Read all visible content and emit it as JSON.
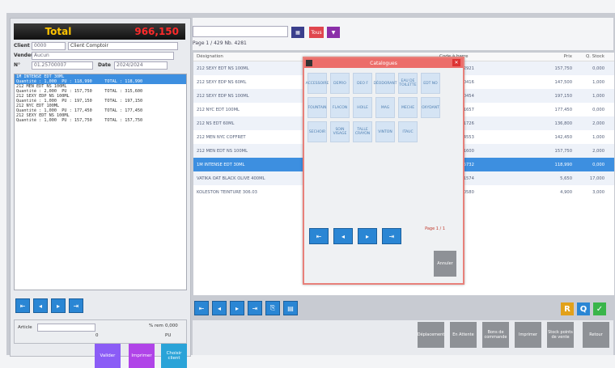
{
  "header": {
    "total_label": "Total",
    "total_value": "966,150"
  },
  "client": {
    "client_label": "Client",
    "client_code": "0000",
    "client_name": "Client Comptoir",
    "vendeur_label": "Vendeur",
    "vendeur_value": "Aucun",
    "no_label": "N°",
    "no_value": "01.25700007",
    "date_label": "Date",
    "date_value": "2024/2024"
  },
  "ticket_lines": [
    {
      "text": "1M INTENSE EDT 30ML",
      "sel": true
    },
    {
      "text": "Quantité : 1,000  PU : 118,990     TOTAL : 118,990",
      "sel": true
    },
    {
      "text": "212 MEN EDT NS 100ML",
      "sel": false
    },
    {
      "text": "Quantité : 2,000  PU : 157,750     TOTAL : 315,600",
      "sel": false
    },
    {
      "text": "212 SEXY EDP NS 100ML",
      "sel": false
    },
    {
      "text": "Quantité : 1,000  PU : 197,150     TOTAL : 197,150",
      "sel": false
    },
    {
      "text": "212 NYC EDT 100ML",
      "sel": false
    },
    {
      "text": "Quantité : 1,000  PU : 177,450     TOTAL : 177,450",
      "sel": false
    },
    {
      "text": "212 SEXY EDT NS 100ML",
      "sel": false
    },
    {
      "text": "Quantité : 1,000  PU : 157,750     TOTAL : 157,750",
      "sel": false
    }
  ],
  "article": {
    "label": "Article",
    "remise": "% rem",
    "value": "0,000",
    "qty": "0",
    "pu": "PU"
  },
  "left_actions": {
    "valider": "Valider",
    "imprimer": "Imprimer",
    "client": "Choisir client"
  },
  "page_info": "Page 1 / 429 Nb. 4281",
  "tous_label": "Tous",
  "table": {
    "headers": [
      "Désignation",
      "Code à barre",
      "Prix",
      "Q. Stock"
    ],
    "rows": [
      {
        "d": "212 SEXY EDT NS 100ML",
        "c": "8411061862921",
        "p": "157,750",
        "q": "0,000",
        "sel": false
      },
      {
        "d": "212 SEXY EDP NS 60ML",
        "c": "8411061860416",
        "p": "147,500",
        "q": "1,000",
        "sel": false
      },
      {
        "d": "212 SEXY EDP NS 100ML",
        "c": "8411061860454",
        "p": "197,150",
        "q": "1,000",
        "sel": false
      },
      {
        "d": "212 NYC EDT 100ML",
        "c": "8411061251657",
        "p": "177,450",
        "q": "0,000",
        "sel": false
      },
      {
        "d": "212 NS EDT 60ML",
        "c": "8411061251726",
        "p": "136,800",
        "q": "2,000",
        "sel": false
      },
      {
        "d": "212 MEN NYC COFFRET",
        "c": "8411061764553",
        "p": "142,450",
        "q": "1,000",
        "sel": false
      },
      {
        "d": "212 MEN EDT NS 100ML",
        "c": "8411061341600",
        "p": "157,750",
        "q": "2,000",
        "sel": false
      },
      {
        "d": "1M INTENSE EDT 30ML",
        "c": "3349668555732",
        "p": "118,990",
        "q": "0,000",
        "sel": true
      },
      {
        "d": "VATIKA OAT BLACK OLIVE 400ML",
        "c": "6291069701574",
        "p": "5,650",
        "q": "17,000",
        "sel": false
      },
      {
        "d": "KOLESTON TEINTURE 306.03",
        "c": "4056800800580",
        "p": "4,900",
        "q": "3,000",
        "sel": false
      }
    ]
  },
  "catalogue": {
    "title": "Catalogues",
    "items": [
      "ACCESSOIRE",
      "DEPRO",
      "DEO F",
      "DÉODORANT",
      "EAU DE TOILETTE",
      "EDT NO",
      "FOUNTAIN",
      "FLACON",
      "HOILE",
      "MAG",
      "MECHE",
      "OXYDANT",
      "SECHOIR",
      "SOIN VISAGE",
      "TALLE CRAYON",
      "VINTON",
      "ITAUC"
    ],
    "page": "Page 1 / 1",
    "annuler": "Annuler"
  },
  "bottom_actions": [
    "Déplacement",
    "En Attente",
    "Bons de commande",
    "Imprimer",
    "Stock points de vente",
    "Retour"
  ],
  "colors": {
    "valider": "#8b5cf6",
    "imprimer": "#b044e8",
    "client": "#2aa3d8",
    "r": "#e2a11a",
    "q": "#2a86d4",
    "ok": "#3ab54a"
  }
}
